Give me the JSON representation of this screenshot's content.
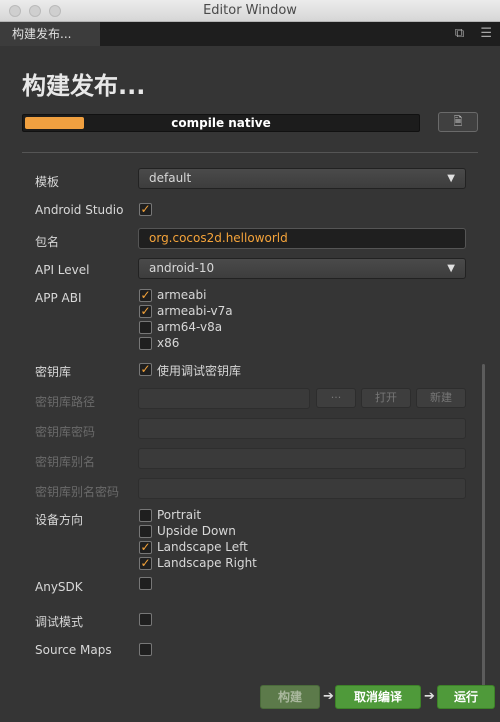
{
  "window": {
    "title": "Editor Window"
  },
  "tab": {
    "label": "构建发布..."
  },
  "icons": {
    "restore": "window-restore-icon",
    "menu": "hamburger-menu-icon",
    "folder": "folder-icon"
  },
  "heading": "构建发布...",
  "progress": {
    "label": "compile native",
    "fraction": 0.15,
    "color": "#f0a040"
  },
  "form": {
    "template": {
      "label": "模板",
      "value": "default"
    },
    "android_studio": {
      "label": "Android Studio",
      "checked": true
    },
    "package": {
      "label": "包名",
      "value": "org.cocos2d.helloworld"
    },
    "api_level": {
      "label": "API Level",
      "value": "android-10"
    },
    "app_abi": {
      "label": "APP ABI",
      "options": [
        {
          "label": "armeabi",
          "checked": true
        },
        {
          "label": "armeabi-v7a",
          "checked": true
        },
        {
          "label": "arm64-v8a",
          "checked": false
        },
        {
          "label": "x86",
          "checked": false
        }
      ]
    },
    "keystore": {
      "label": "密钥库",
      "option": "使用调试密钥库",
      "checked": true
    },
    "keystore_path": {
      "label": "密钥库路径",
      "browse": "···",
      "open": "打开",
      "new": "新建"
    },
    "keystore_password": {
      "label": "密钥库密码"
    },
    "keystore_alias": {
      "label": "密钥库别名"
    },
    "keystore_alias_password": {
      "label": "密钥库别名密码"
    },
    "orientation": {
      "label": "设备方向",
      "options": [
        {
          "label": "Portrait",
          "checked": false
        },
        {
          "label": "Upside Down",
          "checked": false
        },
        {
          "label": "Landscape Left",
          "checked": true
        },
        {
          "label": "Landscape Right",
          "checked": true
        }
      ]
    },
    "anysdk": {
      "label": "AnySDK",
      "checked": false
    },
    "debug": {
      "label": "调试模式",
      "checked": false
    },
    "source_maps": {
      "label": "Source Maps",
      "checked": false
    }
  },
  "actions": {
    "build": "构建",
    "cancel_compile": "取消编译",
    "run": "运行"
  },
  "colors": {
    "accent": "#f4a33a",
    "button_green": "#4f9a3a",
    "panel": "#353535"
  }
}
